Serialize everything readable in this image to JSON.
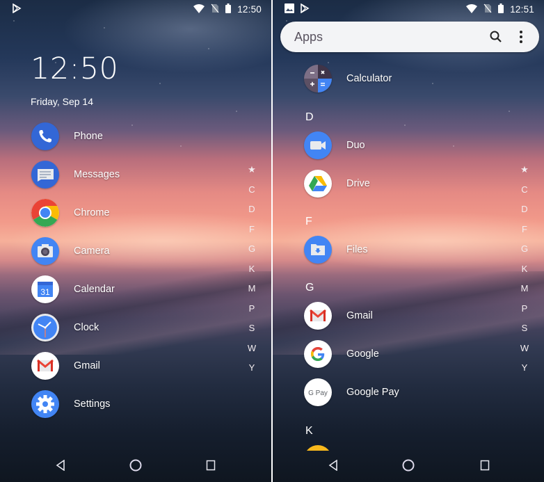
{
  "left_screen": {
    "status_bar": {
      "left_icons": [
        "play-store-notification-icon"
      ],
      "right_icons": [
        "wifi-icon",
        "no-sim-icon",
        "battery-icon"
      ],
      "time": "12:50"
    },
    "clock_widget": {
      "time": "12:50",
      "date": "Friday, Sep 14"
    },
    "apps": [
      {
        "label": "Phone",
        "icon": "phone-icon"
      },
      {
        "label": "Messages",
        "icon": "messages-icon"
      },
      {
        "label": "Chrome",
        "icon": "chrome-icon"
      },
      {
        "label": "Camera",
        "icon": "camera-icon"
      },
      {
        "label": "Calendar",
        "icon": "calendar-icon",
        "icon_text": "31"
      },
      {
        "label": "Clock",
        "icon": "clock-icon"
      },
      {
        "label": "Gmail",
        "icon": "gmail-icon"
      },
      {
        "label": "Settings",
        "icon": "settings-icon"
      }
    ],
    "alpha_index": [
      "★",
      "C",
      "D",
      "F",
      "G",
      "K",
      "M",
      "P",
      "S",
      "W",
      "Y"
    ]
  },
  "right_screen": {
    "status_bar": {
      "left_icons": [
        "image-notification-icon",
        "play-store-notification-icon"
      ],
      "right_icons": [
        "wifi-icon",
        "no-sim-icon",
        "battery-icon"
      ],
      "time": "12:51"
    },
    "search_bar": {
      "placeholder": "Apps",
      "search_icon": "search-icon",
      "menu_icon": "more-vert-icon"
    },
    "sections": [
      {
        "letter": "",
        "apps": [
          {
            "label": "Calculator",
            "icon": "calculator-icon"
          }
        ]
      },
      {
        "letter": "D",
        "apps": [
          {
            "label": "Duo",
            "icon": "duo-icon"
          },
          {
            "label": "Drive",
            "icon": "drive-icon"
          }
        ]
      },
      {
        "letter": "F",
        "apps": [
          {
            "label": "Files",
            "icon": "files-icon"
          }
        ]
      },
      {
        "letter": "G",
        "apps": [
          {
            "label": "Gmail",
            "icon": "gmail-icon"
          },
          {
            "label": "Google",
            "icon": "google-icon"
          },
          {
            "label": "Google Pay",
            "icon": "google-pay-icon",
            "icon_text": "G Pay"
          }
        ]
      },
      {
        "letter": "K",
        "apps": []
      }
    ],
    "alpha_index": [
      "★",
      "C",
      "D",
      "F",
      "G",
      "K",
      "M",
      "P",
      "S",
      "W",
      "Y"
    ]
  },
  "nav_bar": {
    "buttons": [
      "back",
      "home",
      "recents"
    ]
  },
  "colors": {
    "google_blue": "#4285f4",
    "google_red": "#ea4335",
    "google_yellow": "#fbbc05",
    "google_green": "#34a853",
    "search_bar_bg": "#f3f4f6"
  }
}
